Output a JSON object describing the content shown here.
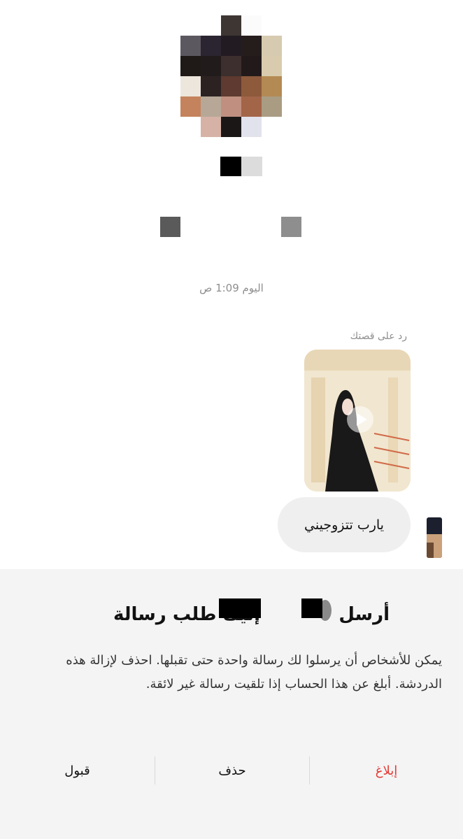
{
  "thread": {
    "timestamp": "اليوم 1:09 ص",
    "story_reply_label": "رد على قصتك",
    "message_text": "يارب تتزوجيني"
  },
  "request": {
    "title_part1": "أرسل",
    "title_part2": "إليك طلب رسالة",
    "body": "يمكن للأشخاص أن يرسلوا لك رسالة واحدة حتى تقبلها. احذف لإزالة هذه الدردشة. أبلغ عن هذا الحساب إذا تلقيت رسالة غير لائقة.",
    "actions": {
      "report": "إبلاغ",
      "delete": "حذف",
      "accept": "قبول"
    }
  },
  "colors": {
    "report": "#e53935",
    "muted_text": "#8e8e8e",
    "sheet_bg": "#f4f4f4",
    "bubble_bg": "#efefef"
  }
}
